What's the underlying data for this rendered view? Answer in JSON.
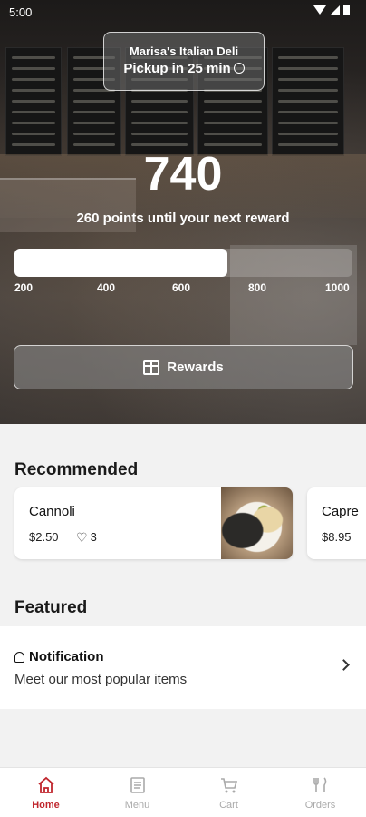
{
  "status_bar": {
    "time": "5:00"
  },
  "store": {
    "name": "Marisa's Italian Deli",
    "pickup": "Pickup in 25 min"
  },
  "rewards": {
    "points": "740",
    "message": "260 points until your next reward",
    "progress_fraction": 0.63,
    "ticks": [
      "200",
      "400",
      "600",
      "800",
      "1000"
    ],
    "button_label": "Rewards"
  },
  "recommended": {
    "title": "Recommended",
    "items": [
      {
        "name": "Cannoli",
        "price": "$2.50",
        "likes": "3"
      },
      {
        "name": "Capre",
        "price": "$8.95"
      }
    ]
  },
  "featured": {
    "title": "Featured",
    "item_title": "Notification",
    "item_subtitle": "Meet our most popular items"
  },
  "nav": [
    {
      "label": "Home",
      "icon": "home-icon"
    },
    {
      "label": "Menu",
      "icon": "menu-icon"
    },
    {
      "label": "Cart",
      "icon": "cart-icon"
    },
    {
      "label": "Orders",
      "icon": "orders-icon"
    }
  ],
  "colors": {
    "accent": "#c0262d"
  }
}
